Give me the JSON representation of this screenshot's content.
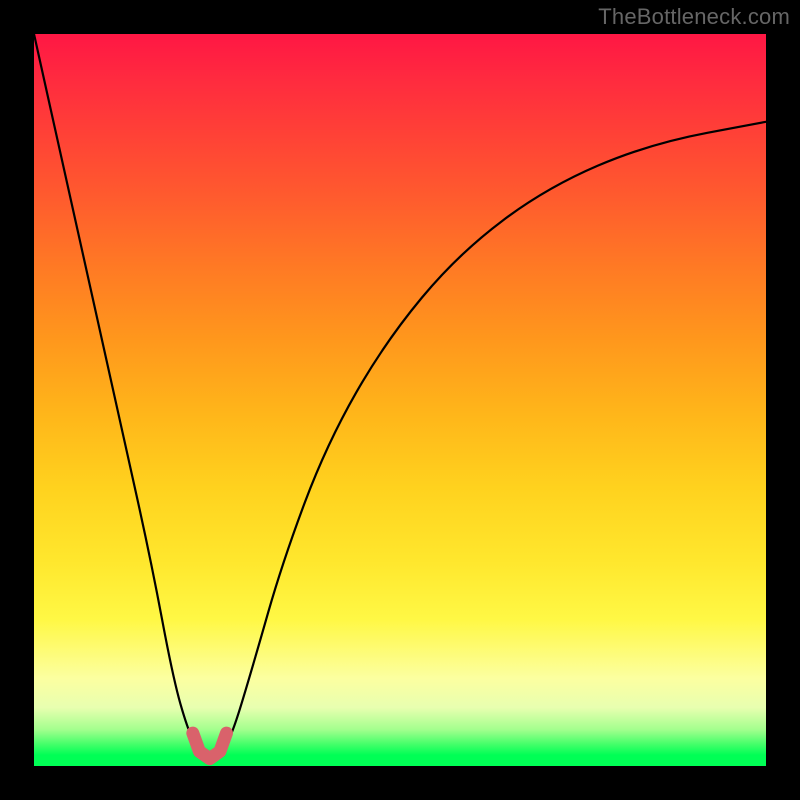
{
  "watermark": "TheBottleneck.com",
  "chart_data": {
    "type": "line",
    "title": "",
    "xlabel": "",
    "ylabel": "",
    "xlim": [
      0,
      100
    ],
    "ylim": [
      0,
      100
    ],
    "grid": false,
    "legend": false,
    "series": [
      {
        "name": "bottleneck-curve",
        "x": [
          0,
          4,
          8,
          12,
          16,
          19,
          21,
          22.5,
          24,
          25.5,
          27,
          30,
          34,
          40,
          48,
          58,
          70,
          84,
          100
        ],
        "values": [
          100,
          82,
          64,
          46,
          28,
          12,
          5,
          2,
          1,
          2,
          4,
          14,
          28,
          44,
          58,
          70,
          79,
          85,
          88
        ]
      }
    ],
    "highlight": {
      "name": "optimal-region-marker",
      "x": [
        21.7,
        22.6,
        24.0,
        25.4,
        26.3
      ],
      "values": [
        4.5,
        2.0,
        1.0,
        2.0,
        4.5
      ]
    },
    "colors": {
      "curve": "#000000",
      "marker": "#d9626b",
      "gradient_top": "#ff1744",
      "gradient_bottom": "#00ff55"
    }
  }
}
